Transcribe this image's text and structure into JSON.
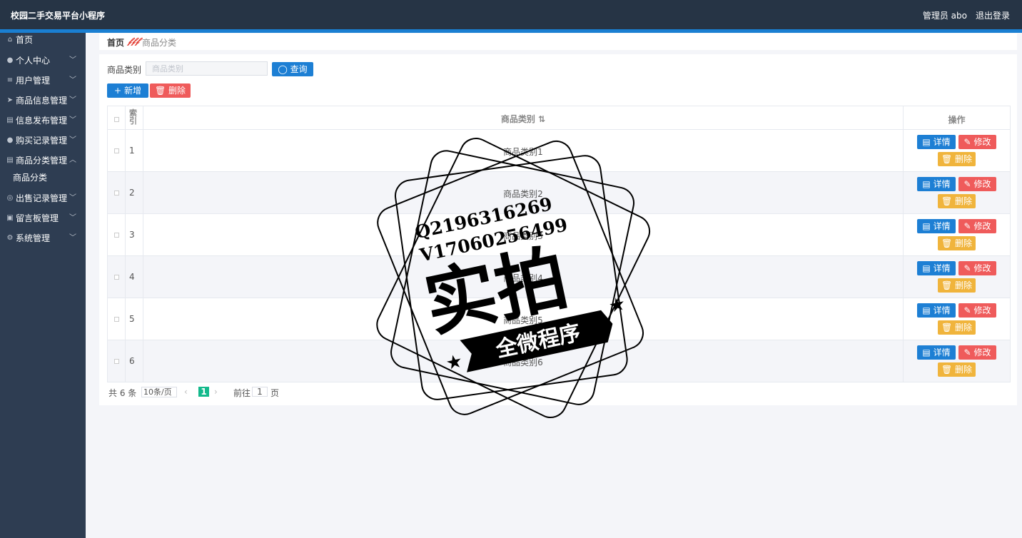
{
  "header": {
    "title": "校园二手交易平台小程序",
    "admin": "管理员 abo",
    "logout": "退出登录"
  },
  "sidebar": {
    "items": [
      {
        "label": "首页",
        "icon": "home-icon"
      },
      {
        "label": "个人中心",
        "icon": "user-icon"
      },
      {
        "label": "用户管理",
        "icon": "list-icon"
      },
      {
        "label": "商品信息管理",
        "icon": "send-icon"
      },
      {
        "label": "信息发布管理",
        "icon": "document-icon"
      },
      {
        "label": "购买记录管理",
        "icon": "user-icon"
      },
      {
        "label": "商品分类管理",
        "icon": "document-icon",
        "expanded": true
      },
      {
        "label": "出售记录管理",
        "icon": "help-circle-icon"
      },
      {
        "label": "留言板管理",
        "icon": "board-icon"
      },
      {
        "label": "系统管理",
        "icon": "settings-icon"
      }
    ],
    "sub_item": "商品分类"
  },
  "breadcrumb": {
    "home": "首页",
    "separator": "𝒻𝒻𝒻",
    "current": "商品分类"
  },
  "search": {
    "label": "商品类别",
    "placeholder": "商品类别",
    "button": "查询"
  },
  "toolbar": {
    "add": "新增",
    "delete": "删除"
  },
  "table": {
    "col_index": "索引",
    "col_category": "商品类别",
    "col_actions": "操作",
    "actions": {
      "detail": "详情",
      "edit": "修改",
      "delete": "删除"
    },
    "rows": [
      {
        "index": "1",
        "category": "商品类别1"
      },
      {
        "index": "2",
        "category": "商品类别2"
      },
      {
        "index": "3",
        "category": "商品类别3"
      },
      {
        "index": "4",
        "category": "商品类别4"
      },
      {
        "index": "5",
        "category": "商品类别5"
      },
      {
        "index": "6",
        "category": "商品类别6"
      }
    ]
  },
  "pagination": {
    "total": "共 6 条",
    "page_size": "10条/页",
    "current": "1",
    "goto_prefix": "前往",
    "goto_value": "1",
    "goto_suffix": "页"
  },
  "watermark": {
    "contact_q": "Q2196316269",
    "contact_v": "V17060256499",
    "main": "实拍",
    "banner": "全微程序"
  },
  "colors": {
    "topbar": "#263445",
    "sidebar": "#2e3d52",
    "accent_blue": "#1d7fd4",
    "danger": "#ef5b5b",
    "warning": "#f0b43c",
    "page_active": "#13b98c"
  }
}
